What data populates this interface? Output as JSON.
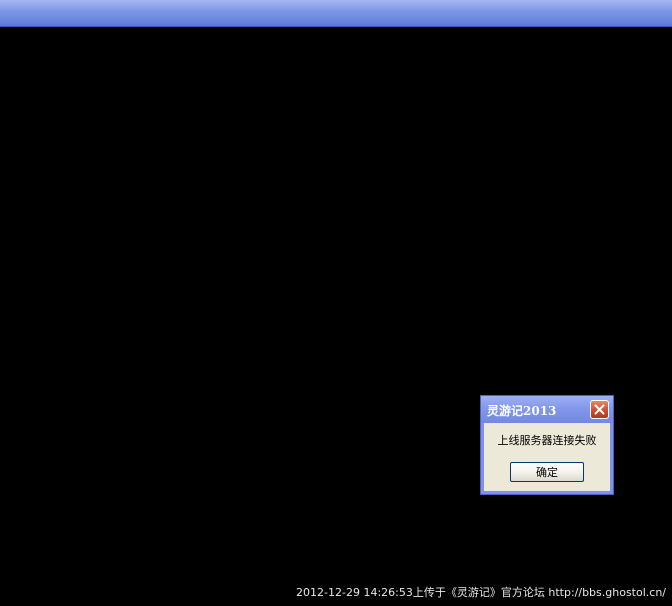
{
  "window": {
    "top_bar_color": "#7f98e6"
  },
  "dialog": {
    "title": "灵游记2013",
    "message": "上线服务器连接失败",
    "ok_label": "确定",
    "close_icon": "close-icon",
    "close_color": "#c94a2a"
  },
  "watermark": {
    "text": "2012-12-29 14:26:53上传于《灵游记》官方论坛 http://bbs.ghostol.cn/"
  }
}
